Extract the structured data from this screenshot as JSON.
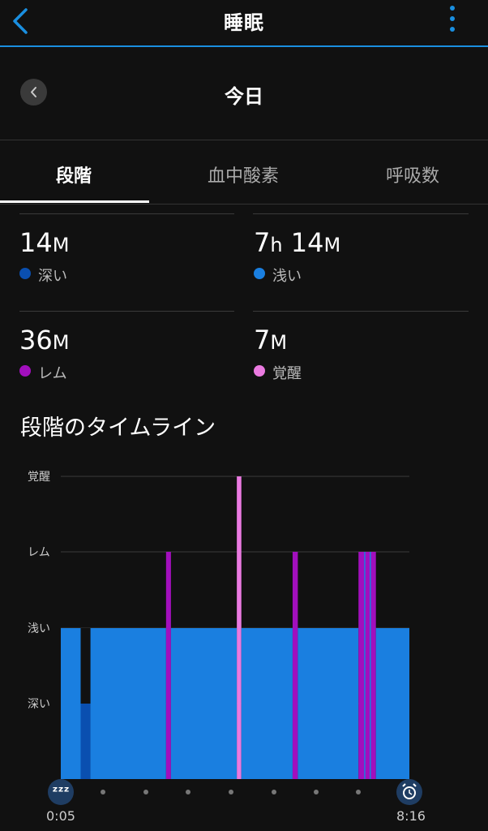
{
  "header": {
    "title": "睡眠"
  },
  "date_nav": {
    "title": "今日"
  },
  "tabs": [
    {
      "label": "段階"
    },
    {
      "label": "血中酸素"
    },
    {
      "label": "呼吸数"
    }
  ],
  "stats": [
    {
      "h": "",
      "h_unit": "",
      "m": "14",
      "m_unit": "M",
      "label": "深い",
      "color": "#0a4fb0"
    },
    {
      "h": "7",
      "h_unit": "h",
      "m": "14",
      "m_unit": "M",
      "label": "浅い",
      "color": "#1a7fe0"
    },
    {
      "h": "",
      "h_unit": "",
      "m": "36",
      "m_unit": "M",
      "label": "レム",
      "color": "#a20fbd"
    },
    {
      "h": "",
      "h_unit": "",
      "m": "7",
      "m_unit": "M",
      "label": "覚醒",
      "color": "#ea7ae0"
    }
  ],
  "timeline": {
    "title": "段階のタイムライン",
    "start_time": "0:05",
    "end_time": "8:16",
    "start_icon": "zzz-icon",
    "end_icon": "alarm-clock-icon"
  },
  "chart_data": {
    "type": "area",
    "levels": [
      "深い",
      "浅い",
      "レム",
      "覚醒"
    ],
    "x_start": "0:05",
    "x_end": "8:16",
    "colors": {
      "深い": "#0a4fb0",
      "浅い": "#1a7fe0",
      "レム": "#a20fbd",
      "覚醒": "#ea7ae0",
      "gap": "#111111"
    },
    "segments": [
      {
        "start": 0.0,
        "end": 0.057,
        "stage": "浅い"
      },
      {
        "start": 0.057,
        "end": 0.085,
        "stage": "深い"
      },
      {
        "start": 0.085,
        "end": 0.302,
        "stage": "浅い"
      },
      {
        "start": 0.302,
        "end": 0.316,
        "stage": "レム"
      },
      {
        "start": 0.316,
        "end": 0.505,
        "stage": "浅い"
      },
      {
        "start": 0.505,
        "end": 0.518,
        "stage": "覚醒"
      },
      {
        "start": 0.518,
        "end": 0.665,
        "stage": "浅い"
      },
      {
        "start": 0.665,
        "end": 0.68,
        "stage": "レム"
      },
      {
        "start": 0.68,
        "end": 0.854,
        "stage": "浅い"
      },
      {
        "start": 0.854,
        "end": 0.904,
        "stage": "レム"
      },
      {
        "start": 0.904,
        "end": 1.0,
        "stage": "浅い"
      }
    ],
    "gap": {
      "start": 0.057,
      "end": 0.085,
      "from_stage": "深い",
      "to_stage": "浅い"
    },
    "grid": true
  }
}
